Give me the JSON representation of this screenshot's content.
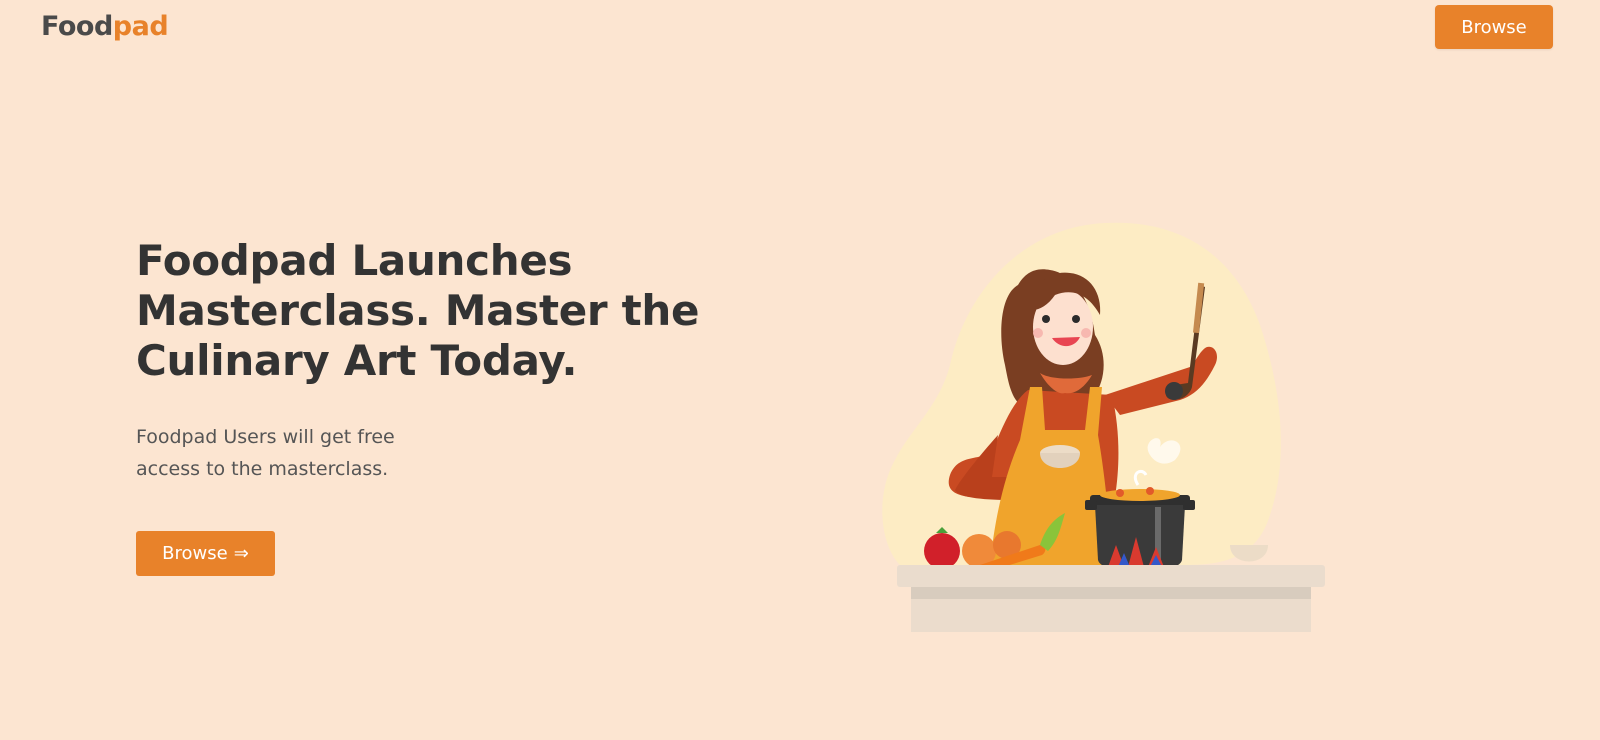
{
  "header": {
    "logo": {
      "part1": "Food",
      "part2": "pad"
    },
    "browse_label": "Browse"
  },
  "hero": {
    "title": "Foodpad Launches Masterclass. Master the Culinary Art Today.",
    "subtitle": "Foodpad Users will get free access to the masterclass.",
    "cta_label": "Browse",
    "cta_icon": "⇒"
  },
  "colors": {
    "background": "#fce5d1",
    "accent": "#e8822a",
    "heading": "#333333"
  },
  "illustration": {
    "icon": "chef-woman-cooking-illustration"
  }
}
